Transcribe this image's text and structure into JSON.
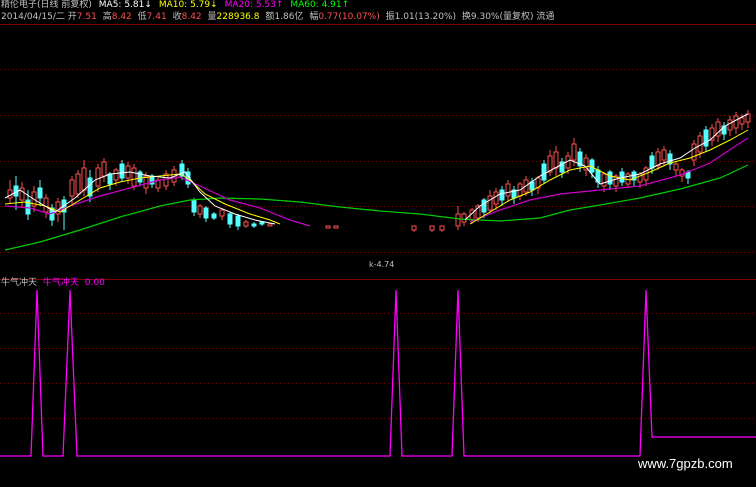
{
  "header1": {
    "stock_name": "精伦电子",
    "period": "(日线 前复权)",
    "ma5_label": "MA5:",
    "ma5_value": "5.81",
    "ma10_label": "MA10:",
    "ma10_value": "5.79",
    "ma20_label": "MA20:",
    "ma20_value": "5.53",
    "ma60_label": "MA60:",
    "ma60_value": "4.91",
    "arrow_down": "↓",
    "arrow_up": "↑"
  },
  "header2": {
    "date": "2014/04/15/二",
    "open_label": "开",
    "open_value": "7.51",
    "high_label": "高",
    "high_value": "8.42",
    "low_label": "低",
    "low_value": "7.41",
    "close_label": "收",
    "close_value": "8.42",
    "volume_label": "量",
    "volume_value": "228936.8",
    "amount_label": "额",
    "amount_value": "1.86亿",
    "change_label": "幅",
    "change_value": "0.77(10.07%)",
    "amplitude_label": "振",
    "amplitude_value": "1.01(13.20%)",
    "turnover_label": "换",
    "turnover_value": "9.30%",
    "adjust_label": "(量复权)",
    "float_label": "流通"
  },
  "price_panel": {
    "low_marker": "k-4.74"
  },
  "indicator_panel": {
    "title": "牛气冲天",
    "series_name": "牛气冲天",
    "series_value": "0.00"
  },
  "watermark": "www.7gpzb.com",
  "colors": {
    "up_candle": "#ff5050",
    "down_candle": "#54ffff",
    "ma5": "#ffffff",
    "ma10": "#ffff00",
    "ma20": "#ff00ff",
    "ma60": "#00ff00",
    "signal": "#ff00ff",
    "grid": "#800000"
  },
  "chart_data": [
    {
      "type": "line",
      "title": "",
      "series": [
        {
          "name": "MA60",
          "values": [
            4.1,
            4.2,
            4.35,
            4.5,
            4.6,
            4.7,
            4.75,
            4.7,
            4.6,
            4.5,
            4.45,
            4.4,
            4.45,
            4.5,
            4.6,
            4.7,
            4.8,
            4.91
          ]
        }
      ]
    },
    {
      "type": "line",
      "title": "",
      "ylim": [
        0,
        1
      ],
      "series": [
        {
          "name": "牛气冲天",
          "values": [
            0,
            1,
            0,
            1,
            0,
            0,
            0,
            0,
            0,
            1,
            0,
            1,
            0,
            0,
            0,
            1,
            0
          ]
        }
      ]
    }
  ]
}
